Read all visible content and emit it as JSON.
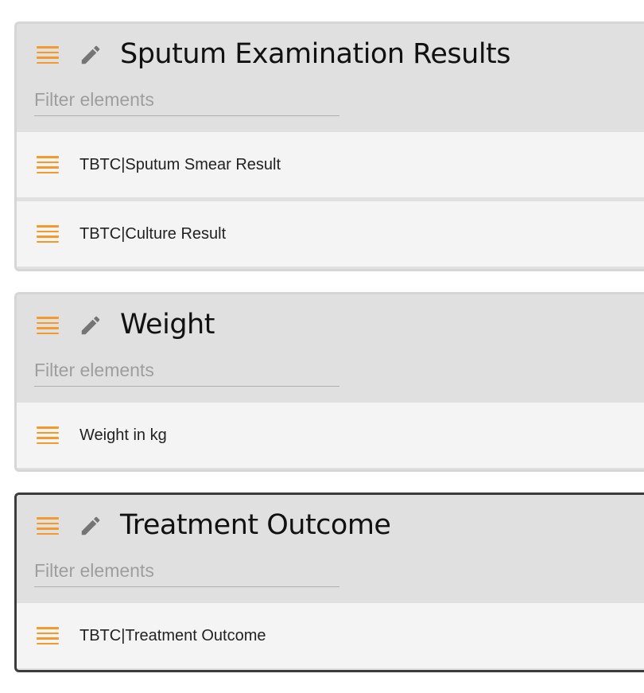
{
  "sections": [
    {
      "title": "Sputum Examination Results",
      "filter_placeholder": "Filter elements",
      "elements": [
        {
          "label": "TBTC|Sputum Smear Result"
        },
        {
          "label": "TBTC|Culture Result"
        }
      ],
      "selected": false
    },
    {
      "title": "Weight",
      "filter_placeholder": "Filter elements",
      "elements": [
        {
          "label": "Weight in kg"
        }
      ],
      "selected": false
    },
    {
      "title": "Treatment Outcome",
      "filter_placeholder": "Filter elements",
      "elements": [
        {
          "label": "TBTC|Treatment Outcome"
        }
      ],
      "selected": true
    }
  ],
  "colors": {
    "drag_handle": "#f39a2b",
    "edit_icon": "#757575",
    "section_bg": "#e0e0e0",
    "element_bg": "#f4f4f4",
    "selected_border": "#3c3c3c"
  },
  "icons": {
    "drag": "drag-handle-icon",
    "edit": "pencil-icon"
  }
}
